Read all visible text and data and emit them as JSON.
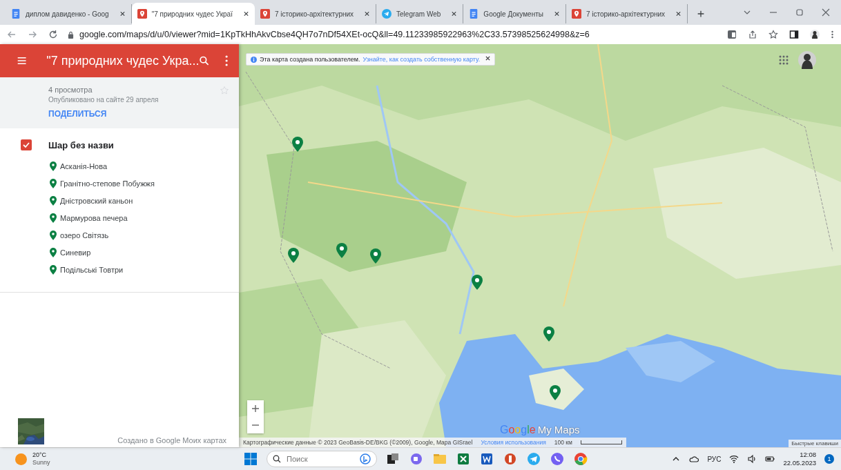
{
  "browser": {
    "tabs": [
      {
        "title": "диплом давиденко - Goog",
        "kind": "docs",
        "selected": false
      },
      {
        "title": "\"7 природних чудес Украї",
        "kind": "maps",
        "selected": true
      },
      {
        "title": "7 історико-архітектурних",
        "kind": "maps",
        "selected": false
      },
      {
        "title": "Telegram Web",
        "kind": "telegram",
        "selected": false
      },
      {
        "title": "Google Документы",
        "kind": "docs",
        "selected": false
      },
      {
        "title": "7 історико-архітектурних",
        "kind": "maps",
        "selected": false
      }
    ],
    "address": "google.com/maps/d/u/0/viewer?mid=1KpTkHhAkvCbse4QH7o7nDf54XEt-ocQ&ll=49.11233985922963%2C33.57398525624998&z=6"
  },
  "sidebar": {
    "title": "\"7 природних чудес Укра...",
    "views": "4 просмотра",
    "published": "Опубликовано на сайте 29 апреля",
    "share": "ПОДЕЛИТЬСЯ",
    "layer": {
      "name": "Шар без назви",
      "checked": true
    },
    "places": [
      "Асканія-Нова",
      "Гранітно-степове Побужжя",
      "Дністровский каньон",
      "Мармурова печера",
      "озеро Світязь",
      "Синевир",
      "Подільські Товтри"
    ],
    "footer": "Создано в Google Моих картах"
  },
  "map": {
    "banner": {
      "text": "Эта карта создана пользователем.",
      "link": "Узнайте, как создать собственную карту."
    },
    "logo": "Google",
    "logo_suffix": "My Maps",
    "attribution": "Картографические данные © 2023 GeoBasis-DE/BKG (©2009), Google, Mapa GISrael",
    "terms": "Условия использования",
    "scale": "100 км",
    "shortcuts": "Быстрые клавиши"
  },
  "taskbar": {
    "temperature": "20°C",
    "weather": "Sunny",
    "search_placeholder": "Поиск",
    "language": "РУС",
    "time": "12:08",
    "date": "22.05.2023",
    "notifications": "1"
  }
}
